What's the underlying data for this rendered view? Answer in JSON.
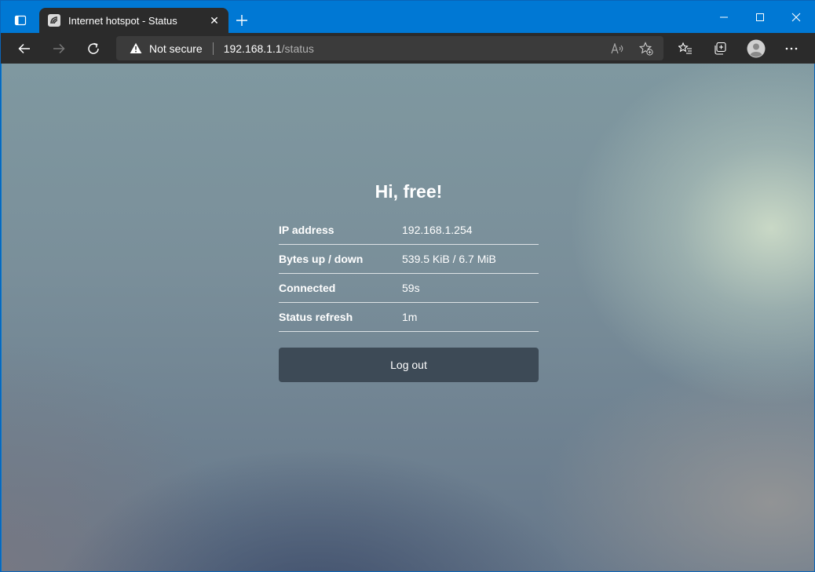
{
  "browser": {
    "tab_title": "Internet hotspot - Status",
    "tab_close": "✕",
    "new_tab": "+",
    "security_label": "Not secure",
    "url_host": "192.168.1.1",
    "url_path": "/status",
    "accent_color": "#0078d4"
  },
  "page": {
    "greeting": "Hi, free!",
    "rows": [
      {
        "label": "IP address",
        "value": "192.168.1.254"
      },
      {
        "label": "Bytes up / down",
        "value": "539.5 KiB / 6.7 MiB"
      },
      {
        "label": "Connected",
        "value": "59s"
      },
      {
        "label": "Status refresh",
        "value": "1m"
      }
    ],
    "logout_label": "Log out",
    "button_color": "#3d4a56"
  }
}
